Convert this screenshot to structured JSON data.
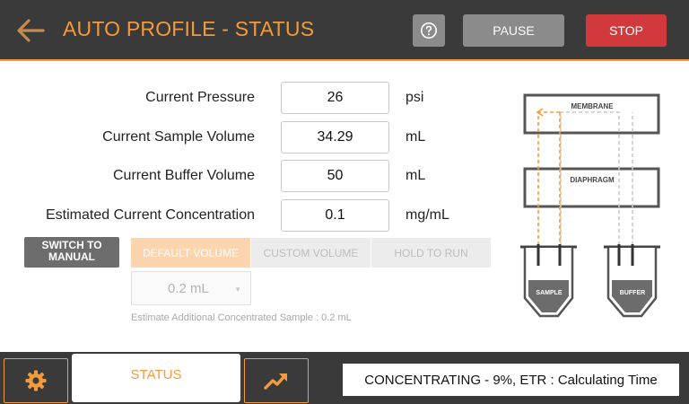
{
  "header": {
    "title": "AUTO PROFILE - STATUS",
    "help_icon": "help-circle-icon",
    "pause_label": "PAUSE",
    "stop_label": "STOP"
  },
  "readings": [
    {
      "label": "Current Pressure",
      "value": "26",
      "unit": "psi"
    },
    {
      "label": "Current Sample Volume",
      "value": "34.29",
      "unit": "mL"
    },
    {
      "label": "Current Buffer Volume",
      "value": "50",
      "unit": "mL"
    },
    {
      "label": "Estimated Current Concentration",
      "value": "0.1",
      "unit": "mg/mL"
    }
  ],
  "controls": {
    "switch_label": "SWITCH TO MANUAL",
    "modes": [
      "DEFAULT VOLUME",
      "CUSTOM VOLUME",
      "HOLD TO RUN"
    ],
    "selected_volume": "0.2 mL",
    "estimate_text": "Estimate Additional Concentrated Sample : 0.2 mL"
  },
  "diagram": {
    "membrane_label": "MEMBRANE",
    "diaphragm_label": "DIAPHRAGM",
    "sample_label": "SAMPLE",
    "buffer_label": "BUFFER"
  },
  "footer": {
    "tab_label": "STATUS",
    "status_text": "CONCENTRATING - 9%, ETR : Calculating Time"
  },
  "colors": {
    "accent": "#f39a3c",
    "header_bg": "#3a3a3a",
    "stop": "#d1393d",
    "neutral_button": "#8b8b8b"
  }
}
